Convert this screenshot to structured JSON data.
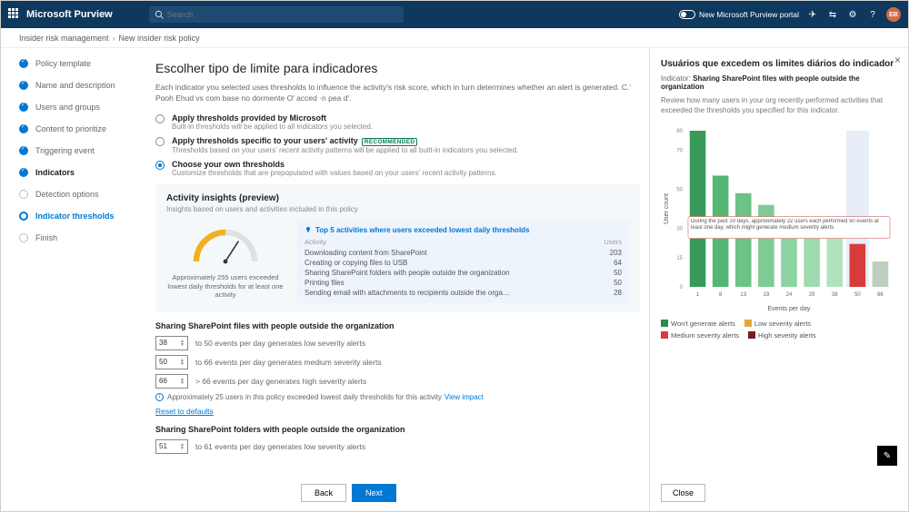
{
  "header": {
    "app_title": "Microsoft Purview",
    "search_placeholder": "Search",
    "portal_toggle_label": "New Microsoft Purview portal",
    "avatar_initials": "EB"
  },
  "breadcrumb": {
    "root": "Insider risk management",
    "current": "New insider risk policy"
  },
  "steps": [
    {
      "label": "Policy template",
      "state": "done"
    },
    {
      "label": "Name and description",
      "state": "done"
    },
    {
      "label": "Users and groups",
      "state": "done"
    },
    {
      "label": "Content to prioritize",
      "state": "done"
    },
    {
      "label": "Triggering event",
      "state": "done"
    },
    {
      "label": "Indicators",
      "state": "bold"
    },
    {
      "label": "Detection options",
      "state": "future"
    },
    {
      "label": "Indicator thresholds",
      "state": "current"
    },
    {
      "label": "Finish",
      "state": "future"
    }
  ],
  "main": {
    "title": "Escolher tipo de limite para indicadores",
    "desc": "Each indicator you selected uses thresholds to influence the activity's risk score, which in turn determines whether an alert is generated. C.' Pooh Ehud vs com base no dormente O' acced ·n pea d'.",
    "radios": [
      {
        "label": "Apply thresholds provided by Microsoft",
        "sub": "Built-in thresholds will be applied to all indicators you selected."
      },
      {
        "label": "Apply thresholds specific to your users' activity",
        "sub": "Thresholds based on your users' recent activity patterns will be applied to all built-in indicators you selected.",
        "recommended": "RECOMMENDED"
      },
      {
        "label": "Choose your own thresholds",
        "sub": "Customize thresholds that are prepopulated with values based on your users' recent activity patterns."
      }
    ],
    "insights": {
      "title": "Activity insights (preview)",
      "sub": "Insights based on users and activities included in this policy",
      "gauge_caption": "Approximately 255 users exceeded lowest daily thresholds for at least one activity",
      "table_title": "Top 5 activities where users exceeded lowest daily thresholds",
      "col_activity": "Activity",
      "col_users": "Users",
      "rows": [
        {
          "a": "Downloading content from SharePoint",
          "u": "203"
        },
        {
          "a": "Creating or copying files to USB",
          "u": "64"
        },
        {
          "a": "Sharing SharePoint folders with people outside the organization",
          "u": "50"
        },
        {
          "a": "Printing files",
          "u": "50"
        },
        {
          "a": "Sending email with attachments to recipients outside the orga…",
          "u": "28"
        }
      ]
    },
    "thresholds1": {
      "title": "Sharing SharePoint files with people outside the organization",
      "rows": [
        {
          "v": "38",
          "t": "to 50 events per day generates low severity alerts"
        },
        {
          "v": "50",
          "t": "to 66 events per day generates medium severity alerts"
        },
        {
          "v": "66",
          "t": "> 66 events per day generates high severity alerts"
        }
      ],
      "info": "Approximately 25 users in this policy exceeded lowest daily thresholds for this activity",
      "view_impact": "View impact",
      "reset": "Reset to defaults"
    },
    "thresholds2": {
      "title": "Sharing SharePoint folders with people outside the organization",
      "rows": [
        {
          "v": "51",
          "t": "to 61 events per day generates low severity alerts"
        }
      ]
    },
    "back": "Back",
    "next": "Next"
  },
  "panel": {
    "title": "Usuários que excedem os limites diários do indicador",
    "indicator_prefix": "Indicator:",
    "indicator": "Sharing SharePoint files with people outside the organization",
    "review": "Review how many users in your org recently performed activities that exceeded the thresholds you specified for this indicator.",
    "callout": "During the past 10 days, approximately 22 users each performed 50 events at least one day, which might generate medium severity alerts",
    "xlabel": "Events per day",
    "ylabel": "User count",
    "close": "Close",
    "legend": {
      "wont": "Won't generate alerts",
      "low": "Low severity alerts",
      "med": "Medium severity alerts",
      "high": "High severity alerts"
    }
  },
  "chart_data": {
    "type": "bar",
    "categories": [
      "1",
      "8",
      "13",
      "19",
      "24",
      "29",
      "38",
      "50",
      "66"
    ],
    "values": [
      80,
      57,
      48,
      42,
      35,
      30,
      25,
      22,
      13
    ],
    "colors": [
      "#3a9a5b",
      "#56b673",
      "#6dc287",
      "#7ecb96",
      "#8ed3a3",
      "#9fdab1",
      "#b1e2bf",
      "#d83b3b",
      "#bfcfbf"
    ],
    "highlight_index": 7,
    "ylim": [
      0,
      80
    ],
    "yticks": [
      0,
      15,
      30,
      50,
      70,
      80
    ],
    "title": "",
    "xlabel": "Events per day",
    "ylabel": "User count"
  }
}
